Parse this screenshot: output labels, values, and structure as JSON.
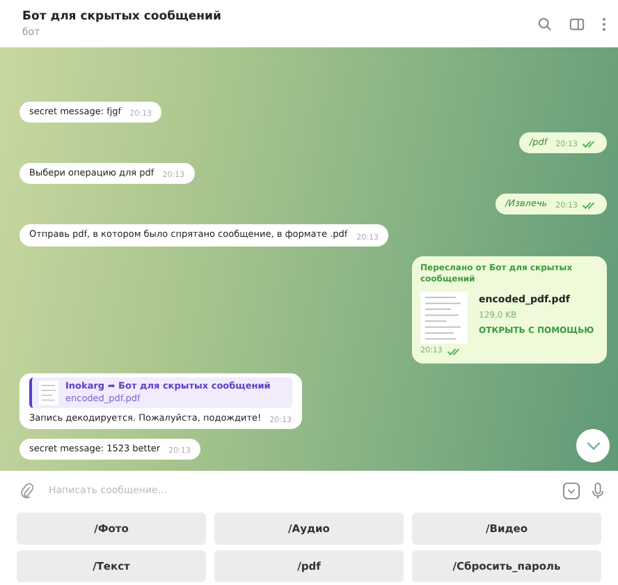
{
  "header": {
    "title": "Бот для скрытых сообщений",
    "subtitle": "бот"
  },
  "messages": [
    {
      "kind": "text",
      "outgoing": false,
      "text": "secret message: fjgf",
      "time": "20:13"
    },
    {
      "kind": "text",
      "outgoing": true,
      "italic": true,
      "text": "/pdf",
      "time": "20:13",
      "read": true
    },
    {
      "kind": "text",
      "outgoing": false,
      "text": "Выбери операцию для pdf",
      "time": "20:13"
    },
    {
      "kind": "text",
      "outgoing": true,
      "italic": true,
      "text": "/Извлечь",
      "time": "20:13",
      "read": true
    },
    {
      "kind": "text",
      "outgoing": false,
      "text": "Отправь pdf, в котором было спрятано сообщение, в формате .pdf",
      "time": "20:13"
    },
    {
      "kind": "file",
      "outgoing": true,
      "forwarded": "Переслано от Бот для скрытых сообщений",
      "filename": "encoded_pdf.pdf",
      "size": "129,0 KB",
      "action": "ОТКРЫТЬ С ПОМОЩЬЮ",
      "time": "20:13",
      "read": true
    },
    {
      "kind": "reply",
      "outgoing": false,
      "reply_author": "Inokarg ➦ Бот для скрытых сообщений",
      "reply_text": "encoded_pdf.pdf",
      "text": "Запись декодируется. Пожалуйста, подождите!",
      "time": "20:13"
    },
    {
      "kind": "text",
      "outgoing": false,
      "text": "secret message: 1523 better",
      "time": "20:13"
    }
  ],
  "composer": {
    "placeholder": "Написать сообщение..."
  },
  "keyboard": [
    [
      "/Фото",
      "/Аудио",
      "/Видео"
    ],
    [
      "/Текст",
      "/pdf",
      "/Сбросить_пароль"
    ]
  ]
}
